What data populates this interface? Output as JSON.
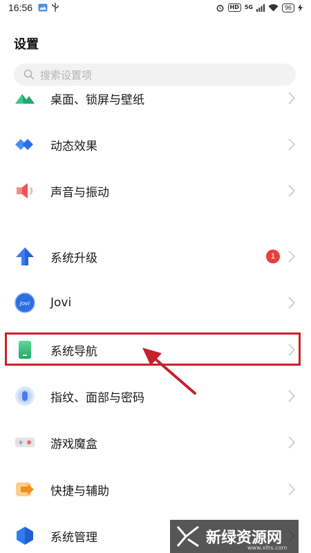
{
  "status_bar": {
    "time": "16:56",
    "hd_label": "HD",
    "network": "5G",
    "battery": "96"
  },
  "page_title": "设置",
  "search": {
    "placeholder": "搜索设置项"
  },
  "items": [
    {
      "label": "桌面、锁屏与壁纸",
      "icon": "wallpaper-icon",
      "color": "#3cc98a"
    },
    {
      "label": "动态效果",
      "icon": "motion-effects-icon",
      "color": "#2f7cf6"
    },
    {
      "label": "声音与振动",
      "icon": "speaker-icon",
      "color": "#f26a6a"
    },
    {
      "label": "系统升级",
      "icon": "system-upgrade-icon",
      "color": "#3b7ef0",
      "badge": "1"
    },
    {
      "label": "Jovi",
      "icon": "jovi-icon",
      "color": "#2c7be5",
      "icon_text": "Jovi"
    },
    {
      "label": "系统导航",
      "icon": "navigation-icon",
      "color": "#35c27a"
    },
    {
      "label": "指纹、面部与密码",
      "icon": "fingerprint-icon",
      "color": "#4a78f0"
    },
    {
      "label": "游戏魔盒",
      "icon": "game-box-icon",
      "color": "#f06a6a"
    },
    {
      "label": "快捷与辅助",
      "icon": "shortcut-icon",
      "color": "#f7a534"
    },
    {
      "label": "系统管理",
      "icon": "system-management-icon",
      "color": "#2f7cf6"
    }
  ],
  "watermark": {
    "text": "新绿资源网",
    "sub": "www.xlhs.com"
  }
}
